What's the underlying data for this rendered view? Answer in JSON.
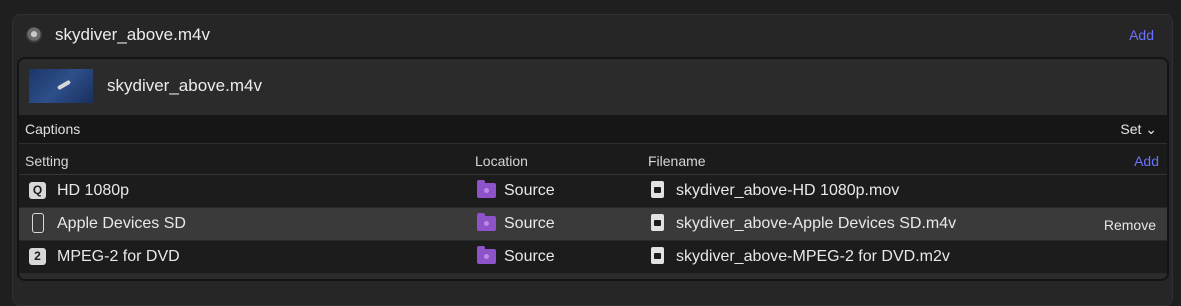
{
  "job": {
    "title": "skydiver_above.m4v",
    "add_label": "Add"
  },
  "source": {
    "title": "skydiver_above.m4v"
  },
  "captions": {
    "label": "Captions",
    "set_label": "Set ⌄"
  },
  "columns": {
    "setting": "Setting",
    "location": "Location",
    "filename": "Filename",
    "add_label": "Add"
  },
  "rows": [
    {
      "icon": "quicktime-icon",
      "icon_glyph": "Q",
      "setting": "HD 1080p",
      "location": "Source",
      "filename": "skydiver_above-HD 1080p.mov",
      "selected": false
    },
    {
      "icon": "phone-icon",
      "icon_glyph": "",
      "setting": "Apple Devices SD",
      "location": "Source",
      "filename": "skydiver_above-Apple Devices SD.m4v",
      "selected": true,
      "action_label": "Remove"
    },
    {
      "icon": "mpeg2-icon",
      "icon_glyph": "2",
      "setting": "MPEG-2 for DVD",
      "location": "Source",
      "filename": "skydiver_above-MPEG-2 for DVD.m2v",
      "selected": false
    }
  ],
  "colors": {
    "accent": "#6b72ff",
    "folder": "#8e52c9",
    "selected_row": "#3a3a3a"
  }
}
